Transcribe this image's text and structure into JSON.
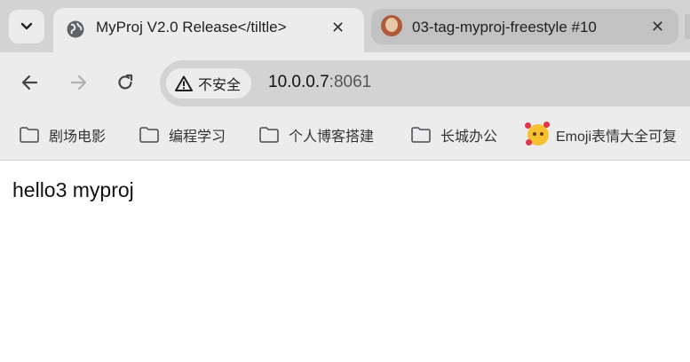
{
  "tabs": [
    {
      "title": "MyProj V2.0 Release</tiltle>",
      "active": true,
      "favicon": "globe-icon"
    },
    {
      "title": "03-tag-myproj-freestyle #10",
      "active": false,
      "favicon": "jenkins-icon"
    }
  ],
  "toolbar": {
    "security_label": "不安全",
    "url_host": "10.0.0.7",
    "url_port": ":8061"
  },
  "bookmarks": [
    {
      "label": "剧场电影",
      "icon": "folder-icon"
    },
    {
      "label": "编程学习",
      "icon": "folder-icon"
    },
    {
      "label": "个人博客搭建",
      "icon": "folder-icon"
    },
    {
      "label": "长城办公",
      "icon": "folder-icon"
    },
    {
      "label": "Emoji表情大全可复",
      "icon": "emoji-icon"
    }
  ],
  "page": {
    "text": "hello3 myproj"
  },
  "colors": {
    "tabstrip_bg": "#d3d3d3",
    "toolbar_bg": "#ececec",
    "omnibox_bg": "#d3d3d3",
    "page_bg": "#ffffff"
  }
}
